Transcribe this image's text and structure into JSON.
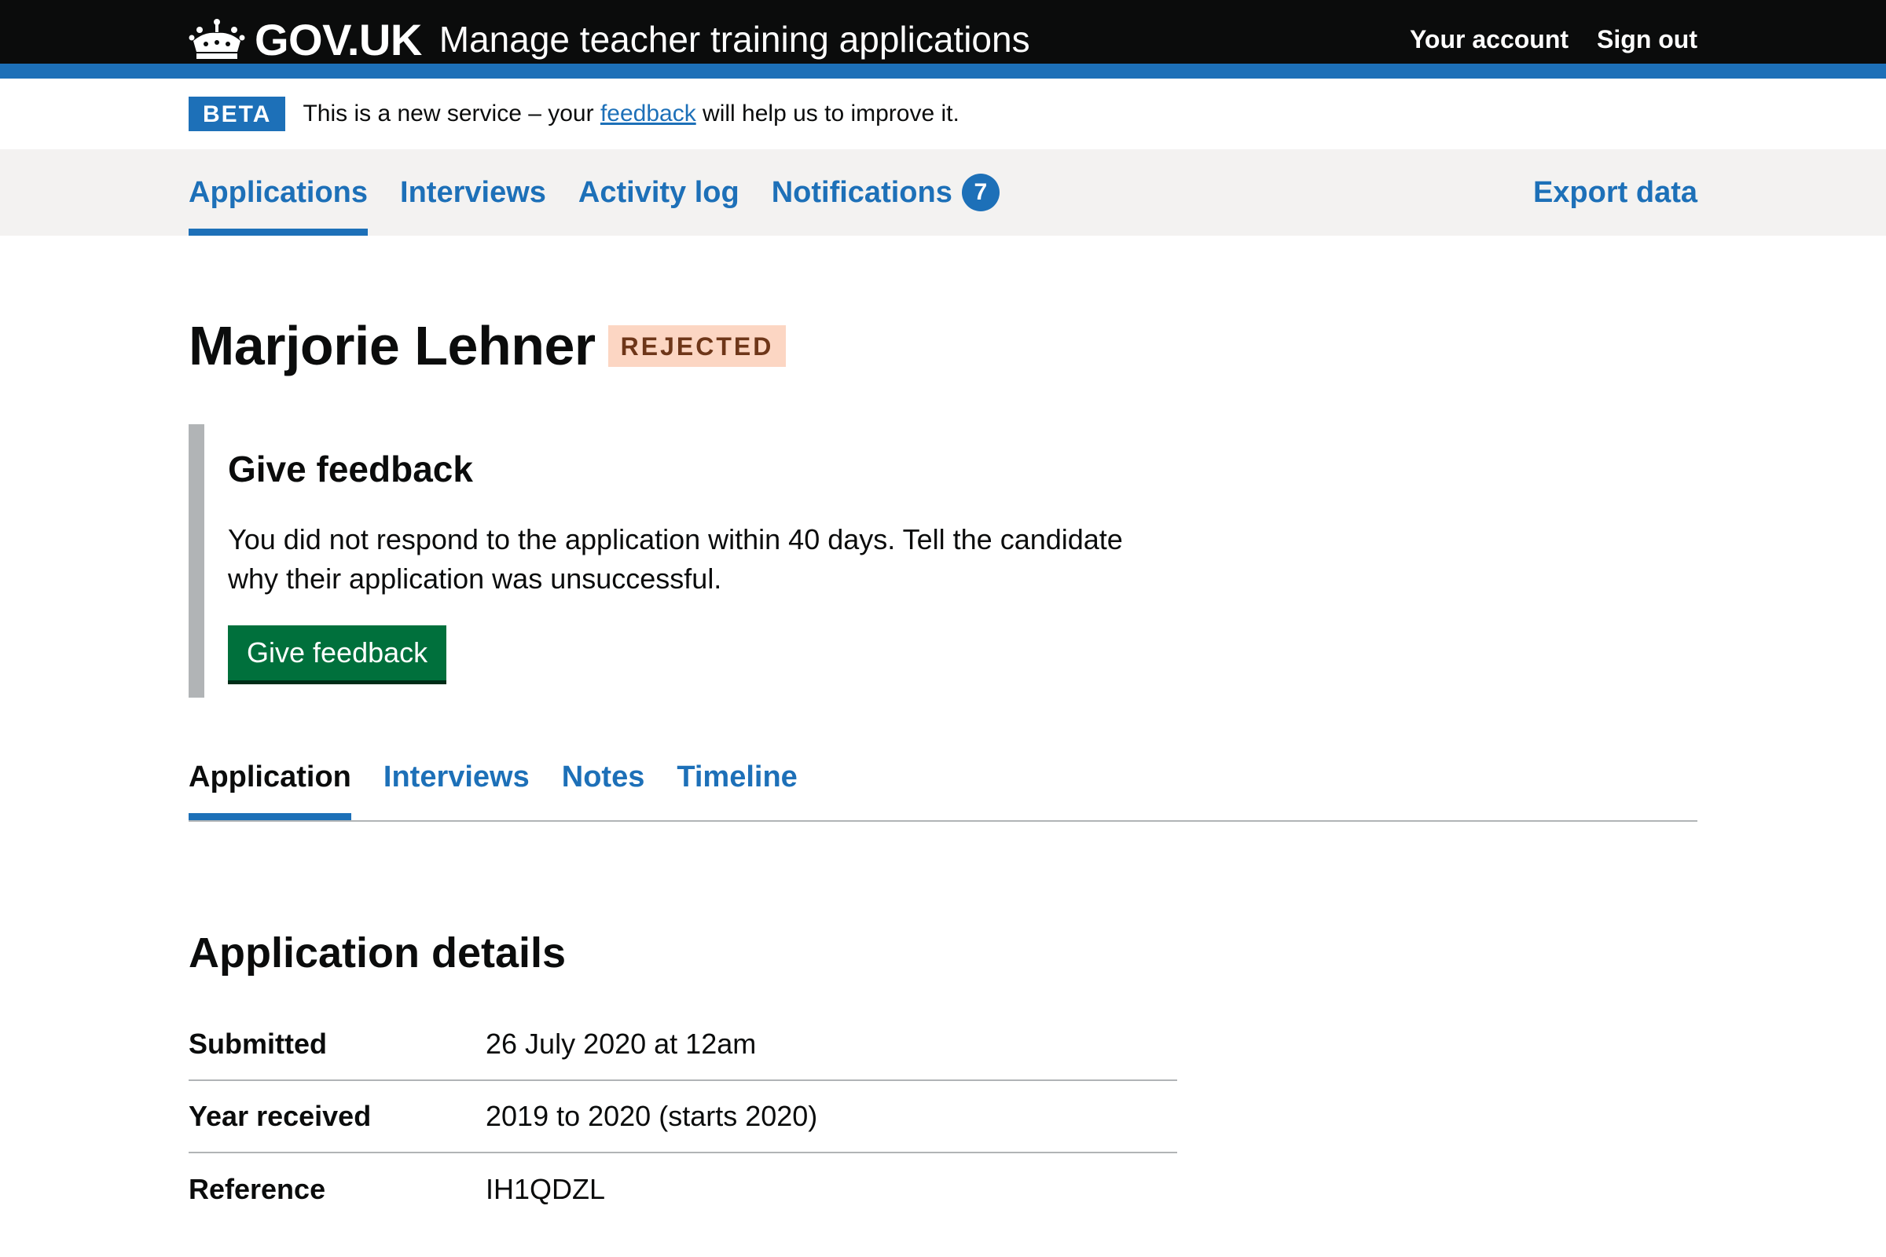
{
  "header": {
    "logotype": "GOV.UK",
    "service_name": "Manage teacher training applications",
    "nav": {
      "account": "Your account",
      "sign_out": "Sign out"
    }
  },
  "phase_banner": {
    "tag": "BETA",
    "text_before": "This is a new service – your ",
    "link": "feedback",
    "text_after": " will help us to improve it."
  },
  "primary_nav": {
    "items": [
      {
        "label": "Applications",
        "current": true
      },
      {
        "label": "Interviews"
      },
      {
        "label": "Activity log"
      },
      {
        "label": "Notifications",
        "count": "7"
      }
    ],
    "export": "Export data"
  },
  "candidate": {
    "name": "Marjorie Lehner",
    "status": "REJECTED"
  },
  "feedback_panel": {
    "heading": "Give feedback",
    "body": "You did not respond to the application within 40 days. Tell the candidate why their application was unsuccessful.",
    "button": "Give feedback"
  },
  "sub_nav": {
    "items": [
      {
        "label": "Application",
        "current": true
      },
      {
        "label": "Interviews"
      },
      {
        "label": "Notes"
      },
      {
        "label": "Timeline"
      }
    ]
  },
  "application_details": {
    "title": "Application details",
    "rows": [
      {
        "key": "Submitted",
        "value": "26 July 2020 at 12am"
      },
      {
        "key": "Year received",
        "value": "2019 to 2020 (starts 2020)"
      },
      {
        "key": "Reference",
        "value": "IH1QDZL"
      }
    ]
  },
  "colors": {
    "header_bg": "#0b0c0c",
    "brand_blue": "#1d70b8",
    "nav_bg": "#f3f2f1",
    "button_green": "#00703c",
    "rejected_tag_bg": "#fcd6c3",
    "rejected_tag_text": "#6e3619"
  }
}
